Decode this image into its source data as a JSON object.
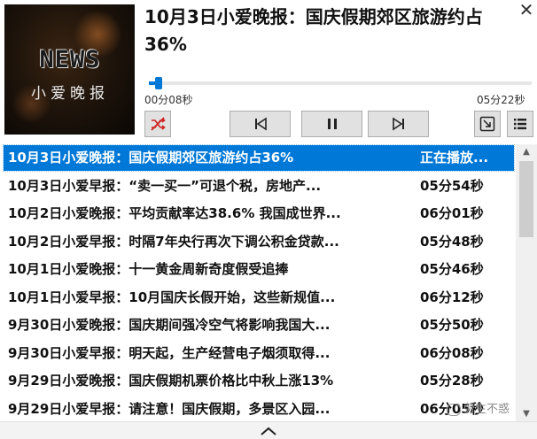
{
  "cover": {
    "news": "NEWS",
    "subtitle": "小爱晚报"
  },
  "now_playing": {
    "title": "10月3日小爱晚报：国庆假期郊区旅游约占36%",
    "elapsed": "00分08秒",
    "total": "05分22秒",
    "progress_fraction": 0.025
  },
  "icons": {
    "close": "close-icon",
    "shuffle": "shuffle-off-icon",
    "prev": "skip-previous-icon",
    "pause": "pause-icon",
    "next": "skip-next-icon",
    "mini": "mini-mode-icon",
    "list": "playlist-icon",
    "collapse": "chevron-up-icon"
  },
  "colors": {
    "accent": "#0078d7",
    "scroll_thumb": "#cdcdcd"
  },
  "playlist": [
    {
      "title": "10月3日小爱晚报：国庆假期郊区旅游约占36%",
      "duration": "正在播放..."
    },
    {
      "title": "10月3日小爱早报：“卖一买一”可退个税，房地产...",
      "duration": "05分54秒"
    },
    {
      "title": "10月2日小爱晚报：平均贡献率达38.6% 我国成世界...",
      "duration": "06分01秒"
    },
    {
      "title": "10月2日小爱早报：时隔7年央行再次下调公积金贷款...",
      "duration": "05分48秒"
    },
    {
      "title": "10月1日小爱晚报：十一黄金周新奇度假受追捧",
      "duration": "05分46秒"
    },
    {
      "title": "10月1日小爱早报：10月国庆长假开始，这些新规值...",
      "duration": "06分12秒"
    },
    {
      "title": "9月30日小爱晚报：国庆期间强冷空气将影响我国大...",
      "duration": "05分50秒"
    },
    {
      "title": "9月30日小爱早报：明天起，生产经营电子烟须取得...",
      "duration": "06分08秒"
    },
    {
      "title": "9月29日小爱晚报：国庆假期机票价格比中秋上涨13%",
      "duration": "05分28秒"
    },
    {
      "title": "9月29日小爱早报：请注意！国庆假期，多景区入园...",
      "duration": "06分05秒"
    }
  ],
  "watermark": "劳生不惑"
}
